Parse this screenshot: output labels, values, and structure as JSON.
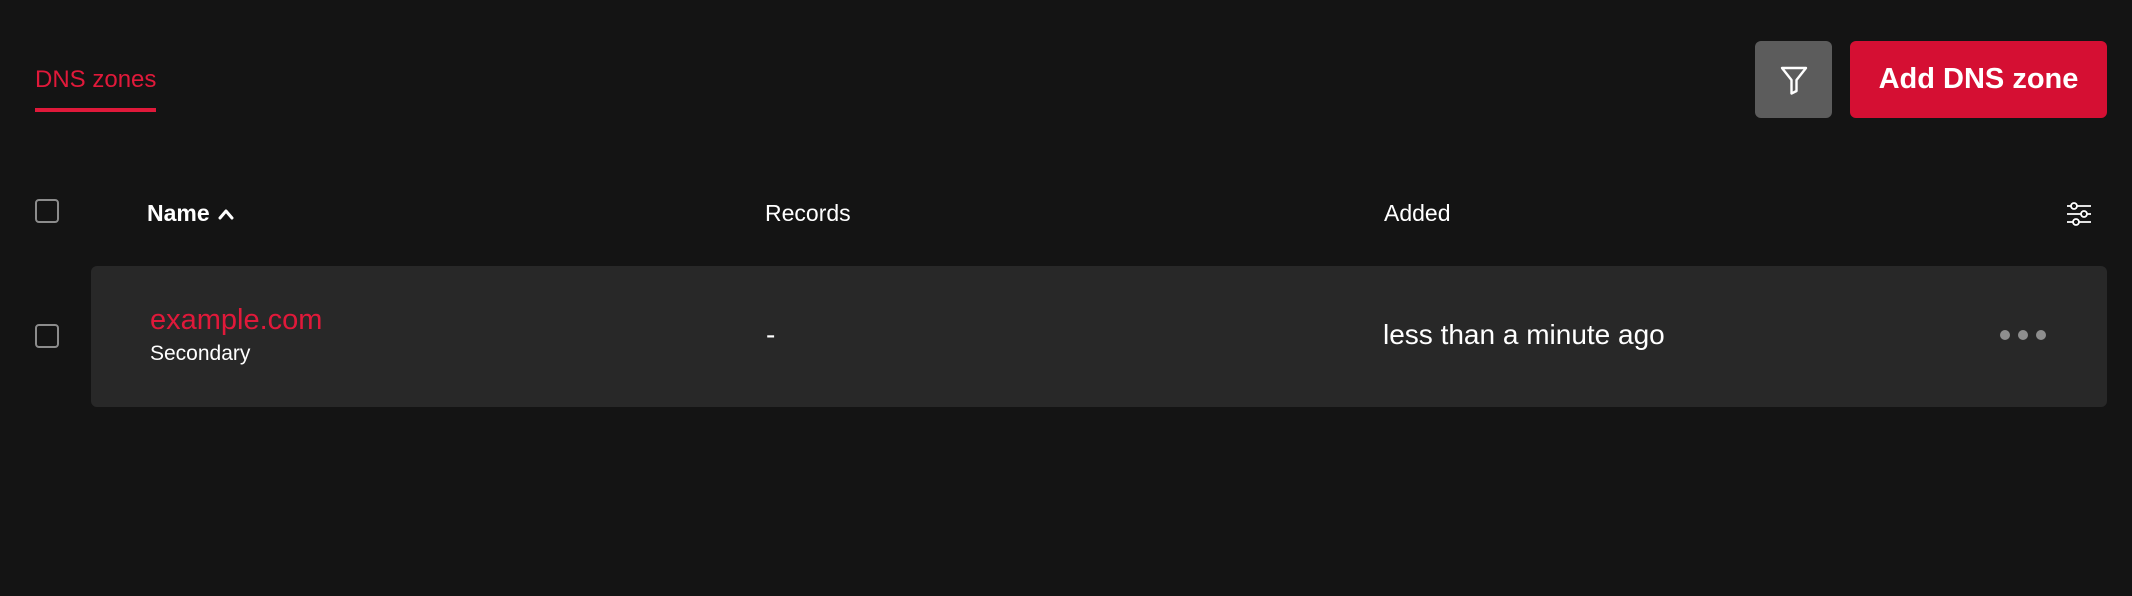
{
  "tabs": [
    {
      "label": "DNS zones",
      "active": true
    }
  ],
  "toolbar": {
    "filter_icon": "filter-icon",
    "add_label": "Add DNS zone"
  },
  "table": {
    "columns": [
      {
        "label": "Name",
        "sort": "ascending"
      },
      {
        "label": "Records"
      },
      {
        "label": "Added"
      }
    ],
    "rows": [
      {
        "name": "example.com",
        "type": "Secondary",
        "records": "-",
        "added": "less than a minute ago"
      }
    ]
  },
  "colors": {
    "accent": "#e0193a",
    "add_button": "#d50f33",
    "background": "#141414",
    "row_background": "#282828",
    "filter_button": "#5c5c5c"
  }
}
